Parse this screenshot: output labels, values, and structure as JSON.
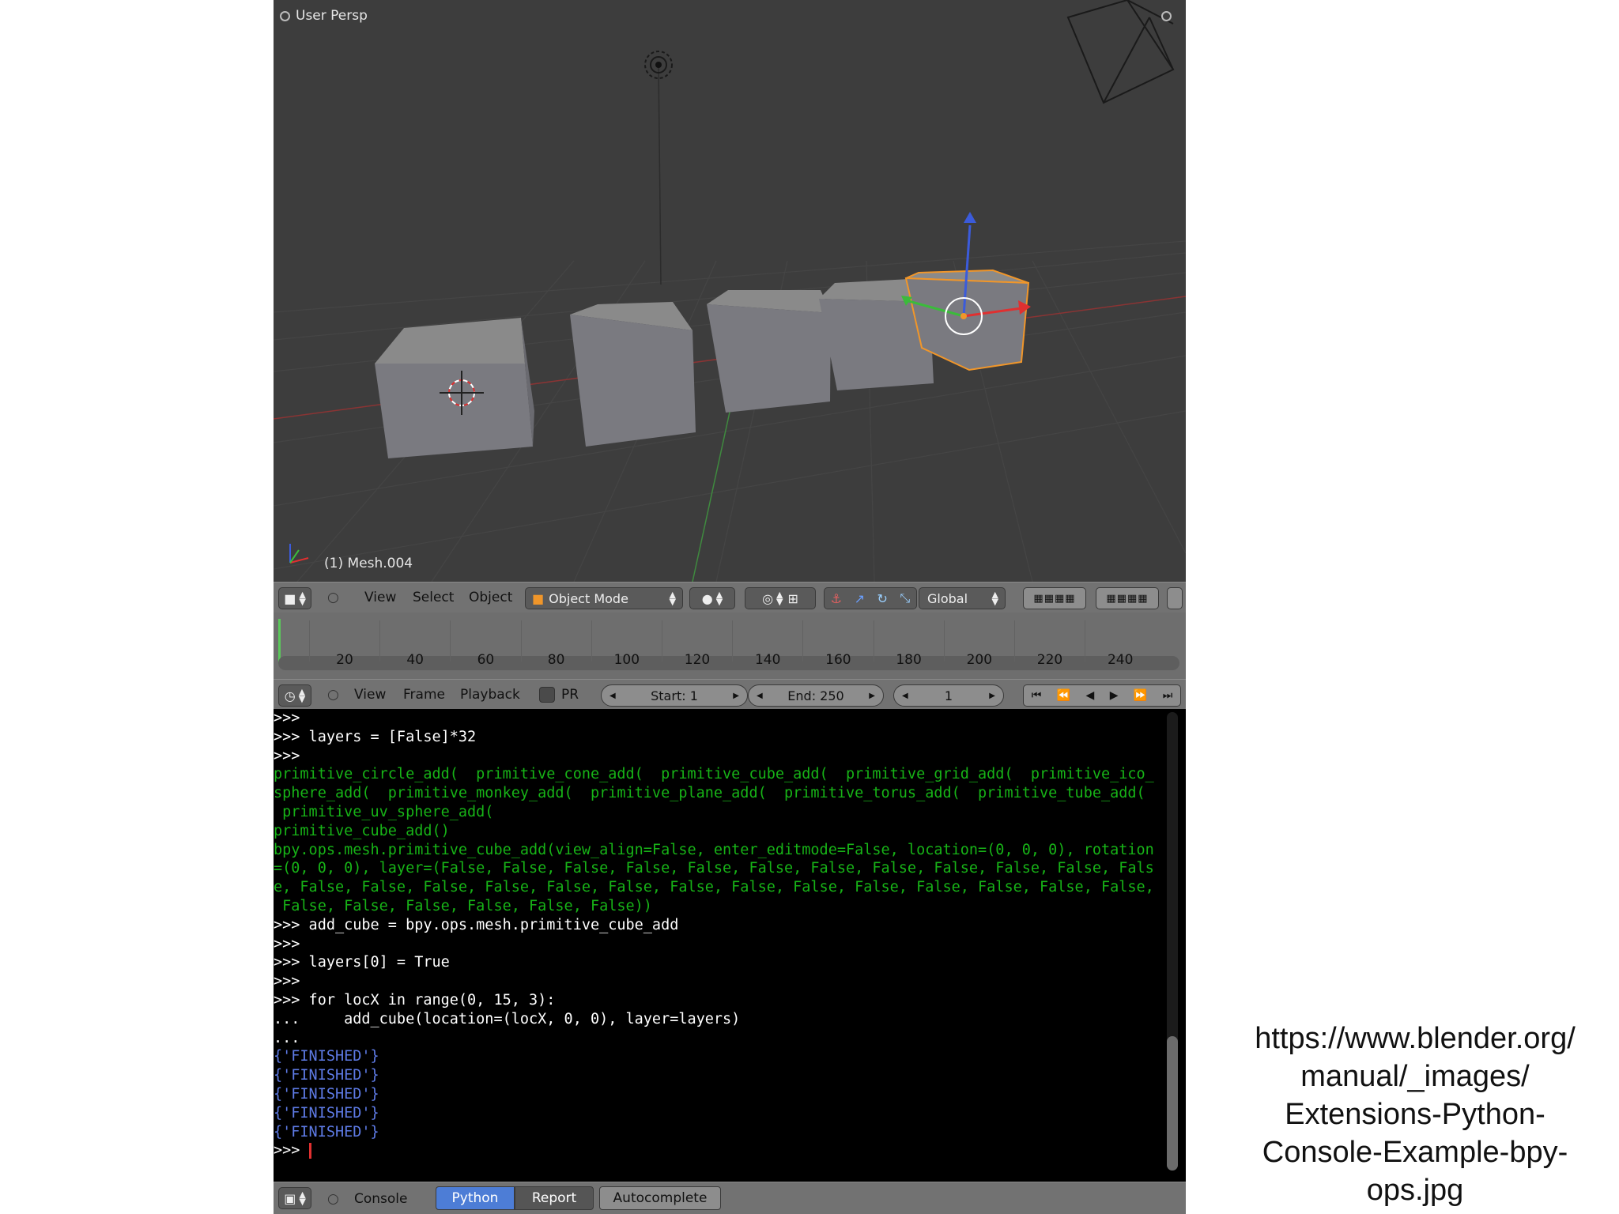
{
  "viewport": {
    "view_name": "User Persp",
    "object_label": "(1) Mesh.004"
  },
  "view3d_header": {
    "menu": [
      "View",
      "Select",
      "Object"
    ],
    "mode": "Object Mode",
    "orientation": "Global"
  },
  "timeline": {
    "ticks": [
      "20",
      "40",
      "60",
      "80",
      "100",
      "120",
      "140",
      "160",
      "180",
      "200",
      "220",
      "240"
    ]
  },
  "timeline_header": {
    "menu": [
      "View",
      "Frame",
      "Playback"
    ],
    "pr_label": "PR",
    "start": "Start: 1",
    "end": "End: 250",
    "current_frame": "1"
  },
  "console": {
    "lines": [
      {
        "t": "in",
        "s": ">>>"
      },
      {
        "t": "in",
        "s": ">>> layers = [False]*32"
      },
      {
        "t": "in",
        "s": ">>>"
      },
      {
        "t": "out",
        "s": "primitive_circle_add(  primitive_cone_add(  primitive_cube_add(  primitive_grid_add(  primitive_ico_"
      },
      {
        "t": "out",
        "s": "sphere_add(  primitive_monkey_add(  primitive_plane_add(  primitive_torus_add(  primitive_tube_add("
      },
      {
        "t": "out",
        "s": " primitive_uv_sphere_add("
      },
      {
        "t": "out",
        "s": "primitive_cube_add()"
      },
      {
        "t": "out",
        "s": "bpy.ops.mesh.primitive_cube_add(view_align=False, enter_editmode=False, location=(0, 0, 0), rotation"
      },
      {
        "t": "out",
        "s": "=(0, 0, 0), layer=(False, False, False, False, False, False, False, False, False, False, False, Fals"
      },
      {
        "t": "out",
        "s": "e, False, False, False, False, False, False, False, False, False, False, False, False, False, False,"
      },
      {
        "t": "out",
        "s": " False, False, False, False, False, False))"
      },
      {
        "t": "in",
        "s": ">>> add_cube = bpy.ops.mesh.primitive_cube_add"
      },
      {
        "t": "in",
        "s": ">>>"
      },
      {
        "t": "in",
        "s": ">>> layers[0] = True"
      },
      {
        "t": "in",
        "s": ">>>"
      },
      {
        "t": "in",
        "s": ">>> for locX in range(0, 15, 3):"
      },
      {
        "t": "in",
        "s": "...     add_cube(location=(locX, 0, 0), layer=layers)"
      },
      {
        "t": "in",
        "s": "..."
      },
      {
        "t": "info",
        "s": "{'FINISHED'}"
      },
      {
        "t": "info",
        "s": "{'FINISHED'}"
      },
      {
        "t": "info",
        "s": "{'FINISHED'}"
      },
      {
        "t": "info",
        "s": "{'FINISHED'}"
      },
      {
        "t": "info",
        "s": "{'FINISHED'}"
      },
      {
        "t": "in",
        "s": ""
      }
    ],
    "prompt": ">>> "
  },
  "console_header": {
    "menu": [
      "Console"
    ],
    "tabs": [
      "Python",
      "Report"
    ],
    "autocomplete": "Autocomplete"
  },
  "caption": {
    "lines": [
      "https://www.blender.org/",
      "manual/_images/",
      "Extensions-Python-",
      "Console-Example-bpy-",
      "ops.jpg"
    ]
  },
  "colors": {
    "console_input": "#ffffff",
    "console_output": "#17b317",
    "console_info": "#5e7be6",
    "selection_outline": "#f0962a",
    "active_tab": "#4d7dd6"
  }
}
